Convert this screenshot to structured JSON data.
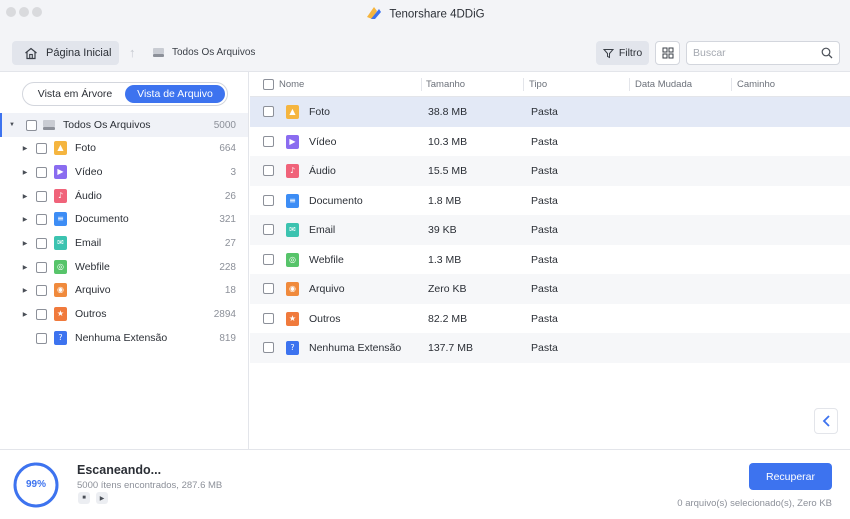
{
  "app": {
    "title": "Tenorshare 4DDiG"
  },
  "toolbar": {
    "home_label": "Página Inicial",
    "breadcrumb": "Todos Os Arquivos",
    "filter_label": "Filtro",
    "search_placeholder": "Buscar"
  },
  "sidebar": {
    "tabs": [
      "Vista em Árvore",
      "Vista de Arquivo"
    ],
    "active_tab": "Vista de Arquivo",
    "root": {
      "label": "Todos Os Arquivos",
      "count": "5000"
    },
    "items": [
      {
        "label": "Foto",
        "count": "664",
        "icon": "image-icon",
        "color": "#f5b53f"
      },
      {
        "label": "Vídeo",
        "count": "3",
        "icon": "video-icon",
        "color": "#8a6cf0"
      },
      {
        "label": "Áudio",
        "count": "26",
        "icon": "audio-icon",
        "color": "#f0637a"
      },
      {
        "label": "Documento",
        "count": "321",
        "icon": "document-icon",
        "color": "#3d8df5"
      },
      {
        "label": "Email",
        "count": "27",
        "icon": "email-icon",
        "color": "#3cc3b0"
      },
      {
        "label": "Webfile",
        "count": "228",
        "icon": "web-icon",
        "color": "#57c46a"
      },
      {
        "label": "Arquivo",
        "count": "18",
        "icon": "archive-icon",
        "color": "#f08a3c"
      },
      {
        "label": "Outros",
        "count": "2894",
        "icon": "star-icon",
        "color": "#f07a3c"
      },
      {
        "label": "Nenhuma Extensão",
        "count": "819",
        "icon": "question-icon",
        "color": "#3d73ef"
      }
    ]
  },
  "table": {
    "columns": [
      "Nome",
      "Tamanho",
      "Tipo",
      "Data Mudada",
      "Caminho"
    ],
    "rows": [
      {
        "name": "Foto",
        "size": "38.8 MB",
        "type": "Pasta"
      },
      {
        "name": "Vídeo",
        "size": "10.3 MB",
        "type": "Pasta"
      },
      {
        "name": "Áudio",
        "size": "15.5 MB",
        "type": "Pasta"
      },
      {
        "name": "Documento",
        "size": "1.8 MB",
        "type": "Pasta"
      },
      {
        "name": "Email",
        "size": "39 KB",
        "type": "Pasta"
      },
      {
        "name": "Webfile",
        "size": "1.3 MB",
        "type": "Pasta"
      },
      {
        "name": "Arquivo",
        "size": "Zero KB",
        "type": "Pasta"
      },
      {
        "name": "Outros",
        "size": "82.2 MB",
        "type": "Pasta"
      },
      {
        "name": "Nenhuma Extensão",
        "size": "137.7 MB",
        "type": "Pasta"
      }
    ]
  },
  "footer": {
    "progress_text": "99%",
    "progress_value": 0.99,
    "status_title": "Escaneando...",
    "status_detail": "5000 ítens encontrados, 287.6 MB",
    "recover_label": "Recuperar",
    "selected_info": "0 arquivo(s) selecionado(s), Zero KB"
  },
  "colors": {
    "accent": "#3d73ef"
  }
}
